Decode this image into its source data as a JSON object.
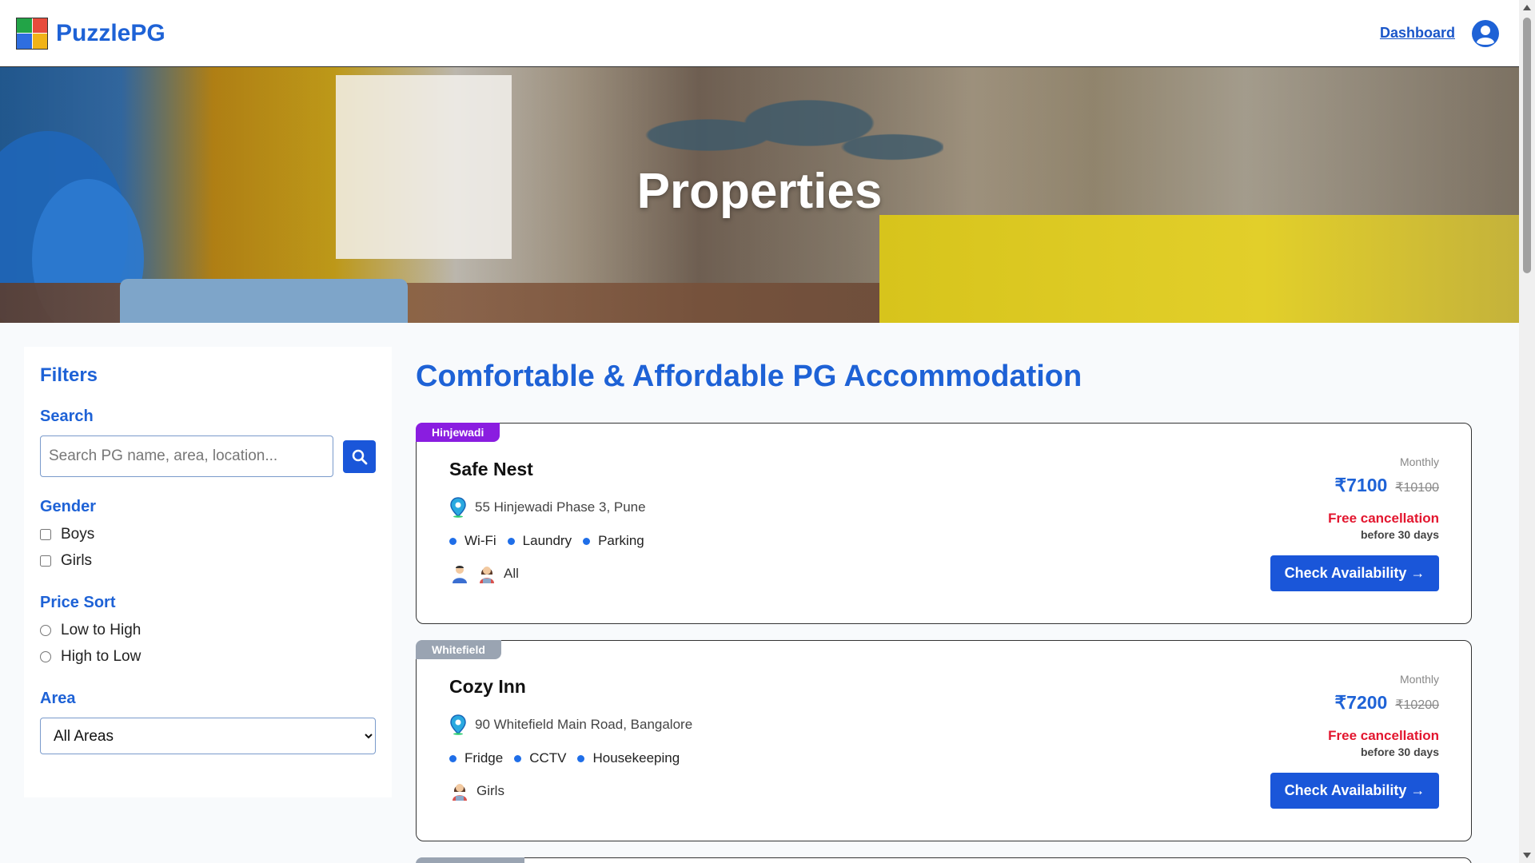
{
  "header": {
    "brand": "PuzzlePG",
    "dashboard_link": "Dashboard",
    "logo_icon": "puzzle-logo-icon",
    "user_icon": "user-circle-icon"
  },
  "hero": {
    "title": "Properties"
  },
  "filters": {
    "title": "Filters",
    "search": {
      "label": "Search",
      "placeholder": "Search PG name, area, location...",
      "value": ""
    },
    "gender": {
      "label": "Gender",
      "options": [
        "Boys",
        "Girls"
      ]
    },
    "price_sort": {
      "label": "Price Sort",
      "options": [
        "Low to High",
        "High to Low"
      ]
    },
    "area": {
      "label": "Area",
      "selected": "All Areas"
    }
  },
  "main": {
    "title": "Comfortable & Affordable PG Accommodation",
    "properties": [
      {
        "tag": "Hinjewadi",
        "name": "Safe Nest",
        "address": "55 Hinjewadi Phase 3, Pune",
        "amenities": [
          "Wi-Fi",
          "Laundry",
          "Parking"
        ],
        "gender": "All",
        "period": "Monthly",
        "price": "₹7100",
        "old_price": "₹10100",
        "cancel": "Free cancellation",
        "cancel_sub": "before 30 days",
        "button": "Check Availability →"
      },
      {
        "tag": "Whitefield",
        "name": "Cozy Inn",
        "address": "90 Whitefield Main Road, Bangalore",
        "amenities": [
          "Fridge",
          "CCTV",
          "Housekeeping"
        ],
        "gender": "Girls",
        "period": "Monthly",
        "price": "₹7200",
        "old_price": "₹10200",
        "cancel": "Free cancellation",
        "cancel_sub": "before 30 days",
        "button": "Check Availability →"
      }
    ]
  },
  "colors": {
    "brand": "#1e62d6",
    "button": "#1a56d9",
    "cancel": "#e3162f",
    "tag_purple": "#8a1de0",
    "tag_gray": "#9aa4b2"
  }
}
